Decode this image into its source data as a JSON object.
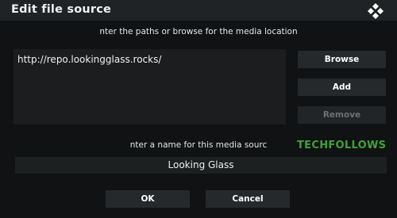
{
  "dialog": {
    "title": "Edit file source",
    "logo_icon": "kodi-logo-icon"
  },
  "paths": {
    "instruction": "nter the paths or browse for the media location",
    "items": [
      "http://repo.lookingglass.rocks/"
    ]
  },
  "actions": {
    "browse_label": "Browse",
    "add_label": "Add",
    "remove_label": "Remove"
  },
  "name": {
    "instruction": "nter a name for this media sourc",
    "value": "Looking Glass"
  },
  "watermark": "TECHFOLLOWS",
  "footer": {
    "ok_label": "OK",
    "cancel_label": "Cancel"
  },
  "colors": {
    "titlebar": "#1f2325",
    "background": "#101213",
    "button": "#26292b",
    "watermark": "#3fa338"
  }
}
